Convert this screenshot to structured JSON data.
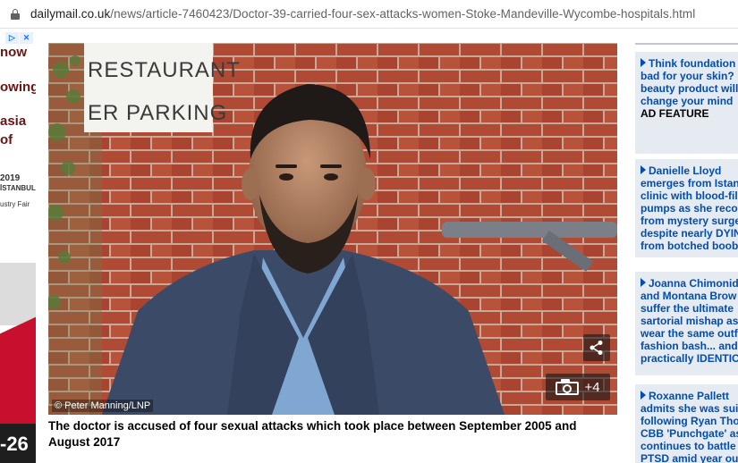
{
  "browser": {
    "url_domain": "dailymail.co.uk",
    "url_path": "/news/article-7460423/Doctor-39-carried-four-sex-attacks-women-Stoke-Mandeville-Wycombe-hospitals.html"
  },
  "left_ad": {
    "lines": [
      "now",
      "owing",
      "asia",
      "of"
    ],
    "year": "2019",
    "city": "İSTANBUL",
    "fair": "ustry Fair",
    "big": "-26"
  },
  "photo": {
    "sign_line1": "RESTAURANT",
    "sign_line2": "ER PARKING",
    "credit": "© Peter Manning/LNP",
    "gallery_count": "+4"
  },
  "caption": "The doctor is accused of four sexual attacks which took place between September 2005 and August 2017",
  "sidebar": {
    "items": [
      {
        "lines": [
          "Think foundation",
          "bad for your skin?",
          "beauty product will",
          "change your mind"
        ],
        "tag": "AD FEATURE"
      },
      {
        "lines": [
          "Danielle Lloyd",
          "emerges from Istan",
          "clinic with blood-fil",
          "pumps as she reco",
          "from mystery surge",
          "despite nearly DYIN",
          "from botched boob"
        ]
      },
      {
        "lines": [
          "Joanna Chimonid",
          "and Montana Brow",
          "suffer the ultimate",
          "sartorial mishap as",
          "wear the same outf",
          "fashion bash... and",
          "practically IDENTIC"
        ]
      },
      {
        "lines": [
          "Roxanne Pallett",
          "admits she was sui",
          "following Ryan Tho",
          "CBB 'Punchgate' as",
          "continues to battle",
          "PTSD amid year ou"
        ]
      }
    ]
  }
}
